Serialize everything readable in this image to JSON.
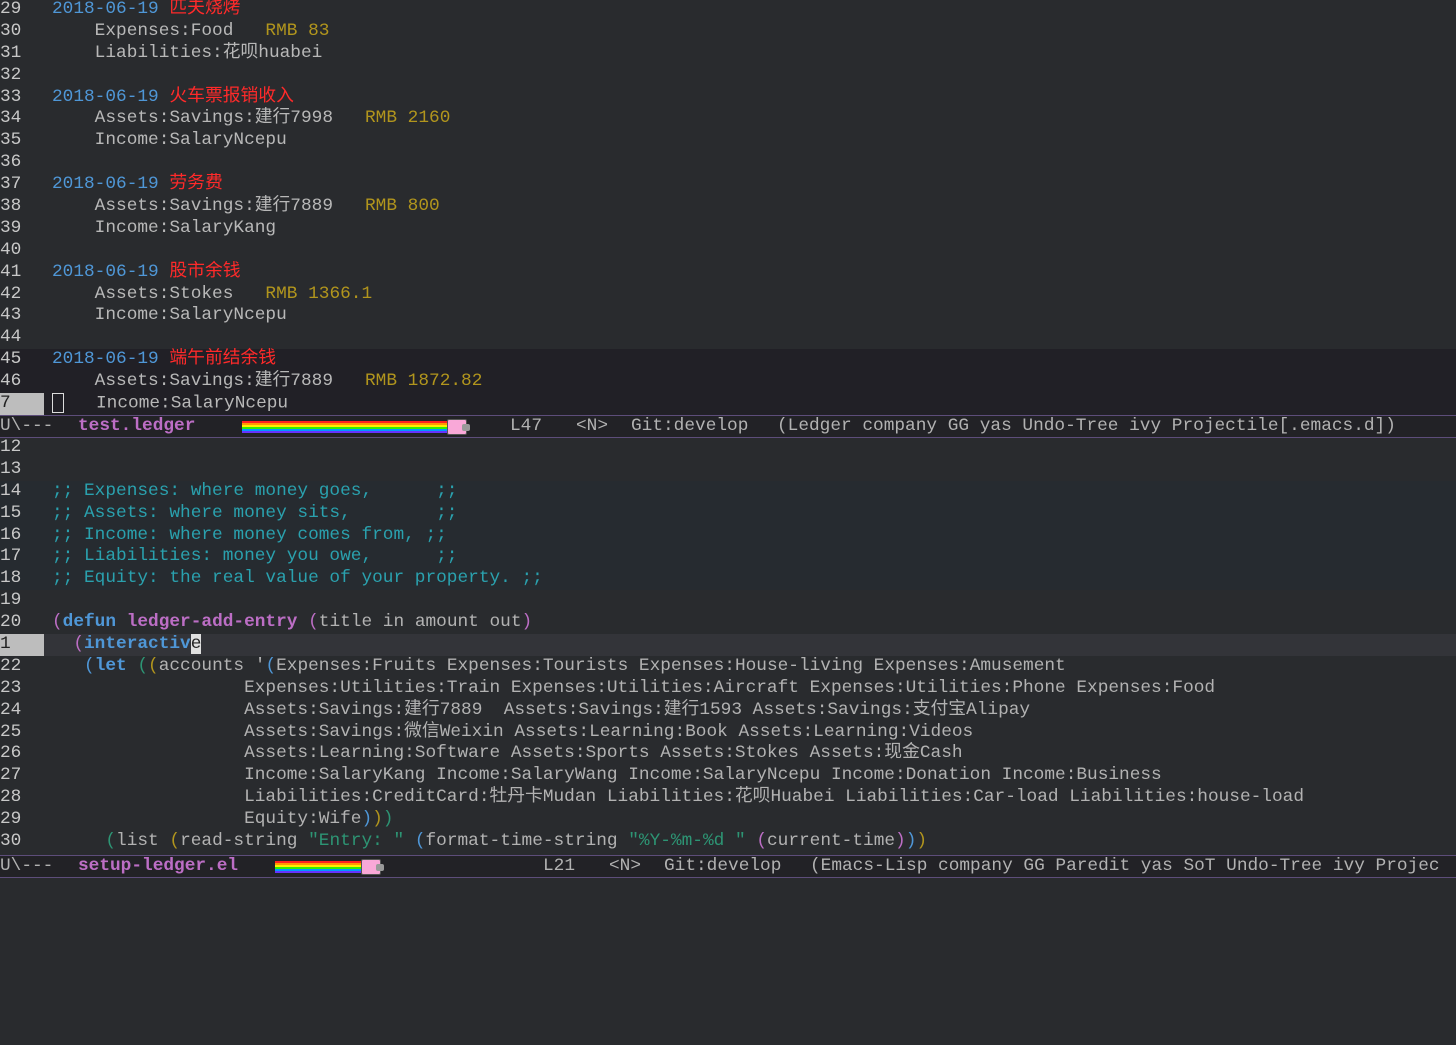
{
  "top_pane": {
    "lines": [
      {
        "n": "29",
        "segs": [
          [
            "date",
            "2018-06-19 "
          ],
          [
            "title",
            "匹夫烧烤"
          ]
        ]
      },
      {
        "n": "30",
        "segs": [
          [
            "acct",
            "    Expenses:Food  "
          ],
          [
            "amt",
            " RMB 83"
          ]
        ]
      },
      {
        "n": "31",
        "segs": [
          [
            "acct",
            "    Liabilities:花呗huabei"
          ]
        ]
      },
      {
        "n": "32",
        "segs": []
      },
      {
        "n": "33",
        "segs": [
          [
            "date",
            "2018-06-19 "
          ],
          [
            "title",
            "火车票报销收入"
          ]
        ]
      },
      {
        "n": "34",
        "segs": [
          [
            "acct",
            "    Assets:Savings:建行7998  "
          ],
          [
            "amt",
            " RMB 2160"
          ]
        ]
      },
      {
        "n": "35",
        "segs": [
          [
            "acct",
            "    Income:SalaryNcepu"
          ]
        ]
      },
      {
        "n": "36",
        "segs": []
      },
      {
        "n": "37",
        "segs": [
          [
            "date",
            "2018-06-19 "
          ],
          [
            "title",
            "劳务费"
          ]
        ]
      },
      {
        "n": "38",
        "segs": [
          [
            "acct",
            "    Assets:Savings:建行7889  "
          ],
          [
            "amt",
            " RMB 800"
          ]
        ]
      },
      {
        "n": "39",
        "segs": [
          [
            "acct",
            "    Income:SalaryKang"
          ]
        ]
      },
      {
        "n": "40",
        "segs": []
      },
      {
        "n": "41",
        "segs": [
          [
            "date",
            "2018-06-19 "
          ],
          [
            "title",
            "股市余钱"
          ]
        ]
      },
      {
        "n": "42",
        "segs": [
          [
            "acct",
            "    Assets:Stokes  "
          ],
          [
            "amt",
            " RMB 1366.1"
          ]
        ]
      },
      {
        "n": "43",
        "segs": [
          [
            "acct",
            "    Income:SalaryNcepu"
          ]
        ]
      },
      {
        "n": "44",
        "segs": []
      },
      {
        "n": "45",
        "region": true,
        "segs": [
          [
            "date",
            "2018-06-19 "
          ],
          [
            "title",
            "端午前结余钱"
          ]
        ]
      },
      {
        "n": "46",
        "region": true,
        "segs": [
          [
            "acct",
            "    Assets:Savings:建行7889  "
          ],
          [
            "amt",
            " RMB 1872.82"
          ]
        ]
      },
      {
        "n": "7",
        "region": true,
        "current": true,
        "cursor_box": true,
        "segs": [
          [
            "acct",
            "   Income:SalaryNcepu"
          ]
        ]
      }
    ]
  },
  "top_modeline": {
    "state": "U\\---",
    "buffer": "test.ledger",
    "nyan_progress": 0.85,
    "line": "L47",
    "evil_state": "<N>",
    "vc": "Git:develop",
    "modes": "(Ledger company GG yas Undo-Tree ivy Projectile[.emacs.d])"
  },
  "bottom_pane": {
    "lines": [
      {
        "n": "12",
        "segs": []
      },
      {
        "n": "13",
        "segs": []
      },
      {
        "n": "14",
        "cmt": true,
        "segs": [
          [
            "comment",
            ";; Expenses: where money goes,      ;;"
          ]
        ]
      },
      {
        "n": "15",
        "cmt": true,
        "segs": [
          [
            "comment",
            ";; Assets: where money sits,        ;;"
          ]
        ]
      },
      {
        "n": "16",
        "cmt": true,
        "segs": [
          [
            "comment",
            ";; Income: where money comes from, ;;"
          ]
        ]
      },
      {
        "n": "17",
        "cmt": true,
        "segs": [
          [
            "comment",
            ";; Liabilities: money you owe,      ;;"
          ]
        ]
      },
      {
        "n": "18",
        "cmt": true,
        "segs": [
          [
            "comment",
            ";; Equity: the real value of your property. ;;"
          ]
        ]
      },
      {
        "n": "19",
        "segs": []
      },
      {
        "n": "20",
        "segs": [
          [
            "p1",
            "("
          ],
          [
            "kw",
            "defun"
          ],
          [
            "plain",
            " "
          ],
          [
            "fn",
            "ledger-add-entry"
          ],
          [
            "plain",
            " "
          ],
          [
            "p1",
            "("
          ],
          [
            "plain",
            "title in amount out"
          ],
          [
            "p1",
            ")"
          ]
        ]
      },
      {
        "n": "1",
        "hl": true,
        "segs": [
          [
            "plain",
            "  "
          ],
          [
            "p1",
            "("
          ],
          [
            "kw",
            "interactiv"
          ],
          [
            "cursor-on",
            "e"
          ]
        ]
      },
      {
        "n": "22",
        "segs": [
          [
            "plain",
            "   "
          ],
          [
            "p2",
            "("
          ],
          [
            "kw",
            "let"
          ],
          [
            "plain",
            " "
          ],
          [
            "p3",
            "("
          ],
          [
            "p4",
            "("
          ],
          [
            "plain",
            "accounts '"
          ],
          [
            "p2",
            "("
          ],
          [
            "plain",
            "Expenses:Fruits Expenses:Tourists Expenses:House-living Expenses:Amusement"
          ]
        ]
      },
      {
        "n": "23",
        "segs": [
          [
            "plain",
            "                  Expenses:Utilities:Train Expenses:Utilities:Aircraft Expenses:Utilities:Phone Expenses:Food"
          ]
        ]
      },
      {
        "n": "24",
        "segs": [
          [
            "plain",
            "                  Assets:Savings:建行7889  Assets:Savings:建行1593 Assets:Savings:支付宝Alipay"
          ]
        ]
      },
      {
        "n": "25",
        "segs": [
          [
            "plain",
            "                  Assets:Savings:微信Weixin Assets:Learning:Book Assets:Learning:Videos"
          ]
        ]
      },
      {
        "n": "26",
        "segs": [
          [
            "plain",
            "                  Assets:Learning:Software Assets:Sports Assets:Stokes Assets:现金Cash"
          ]
        ]
      },
      {
        "n": "27",
        "segs": [
          [
            "plain",
            "                  Income:SalaryKang Income:SalaryWang Income:SalaryNcepu Income:Donation Income:Business"
          ]
        ]
      },
      {
        "n": "28",
        "segs": [
          [
            "plain",
            "                  Liabilities:CreditCard:牡丹卡Mudan Liabilities:花呗Huabei Liabilities:Car-load Liabilities:house-load"
          ]
        ]
      },
      {
        "n": "29",
        "segs": [
          [
            "plain",
            "                  Equity:Wife"
          ],
          [
            "p2",
            ")"
          ],
          [
            "p4",
            ")"
          ],
          [
            "p3",
            ")"
          ]
        ]
      },
      {
        "n": "30",
        "segs": [
          [
            "plain",
            "     "
          ],
          [
            "p3",
            "("
          ],
          [
            "plain",
            "list "
          ],
          [
            "p4",
            "("
          ],
          [
            "plain",
            "read-string "
          ],
          [
            "str",
            "\"Entry: \""
          ],
          [
            "plain",
            " "
          ],
          [
            "p2",
            "("
          ],
          [
            "plain",
            "format-time-string "
          ],
          [
            "str",
            "\"%Y-%m-%d \""
          ],
          [
            "plain",
            " "
          ],
          [
            "p1",
            "("
          ],
          [
            "plain",
            "current-time"
          ],
          [
            "p1",
            ")"
          ],
          [
            "p2",
            ")"
          ],
          [
            "p4",
            ")"
          ]
        ]
      }
    ]
  },
  "bottom_modeline": {
    "state": "U\\---",
    "buffer": "setup-ledger.el",
    "nyan_progress": 0.9,
    "line": "L21",
    "evil_state": "<N>",
    "vc": "Git:develop",
    "modes": "(Emacs-Lisp company GG Paredit yas SoT Undo-Tree ivy Projec"
  }
}
